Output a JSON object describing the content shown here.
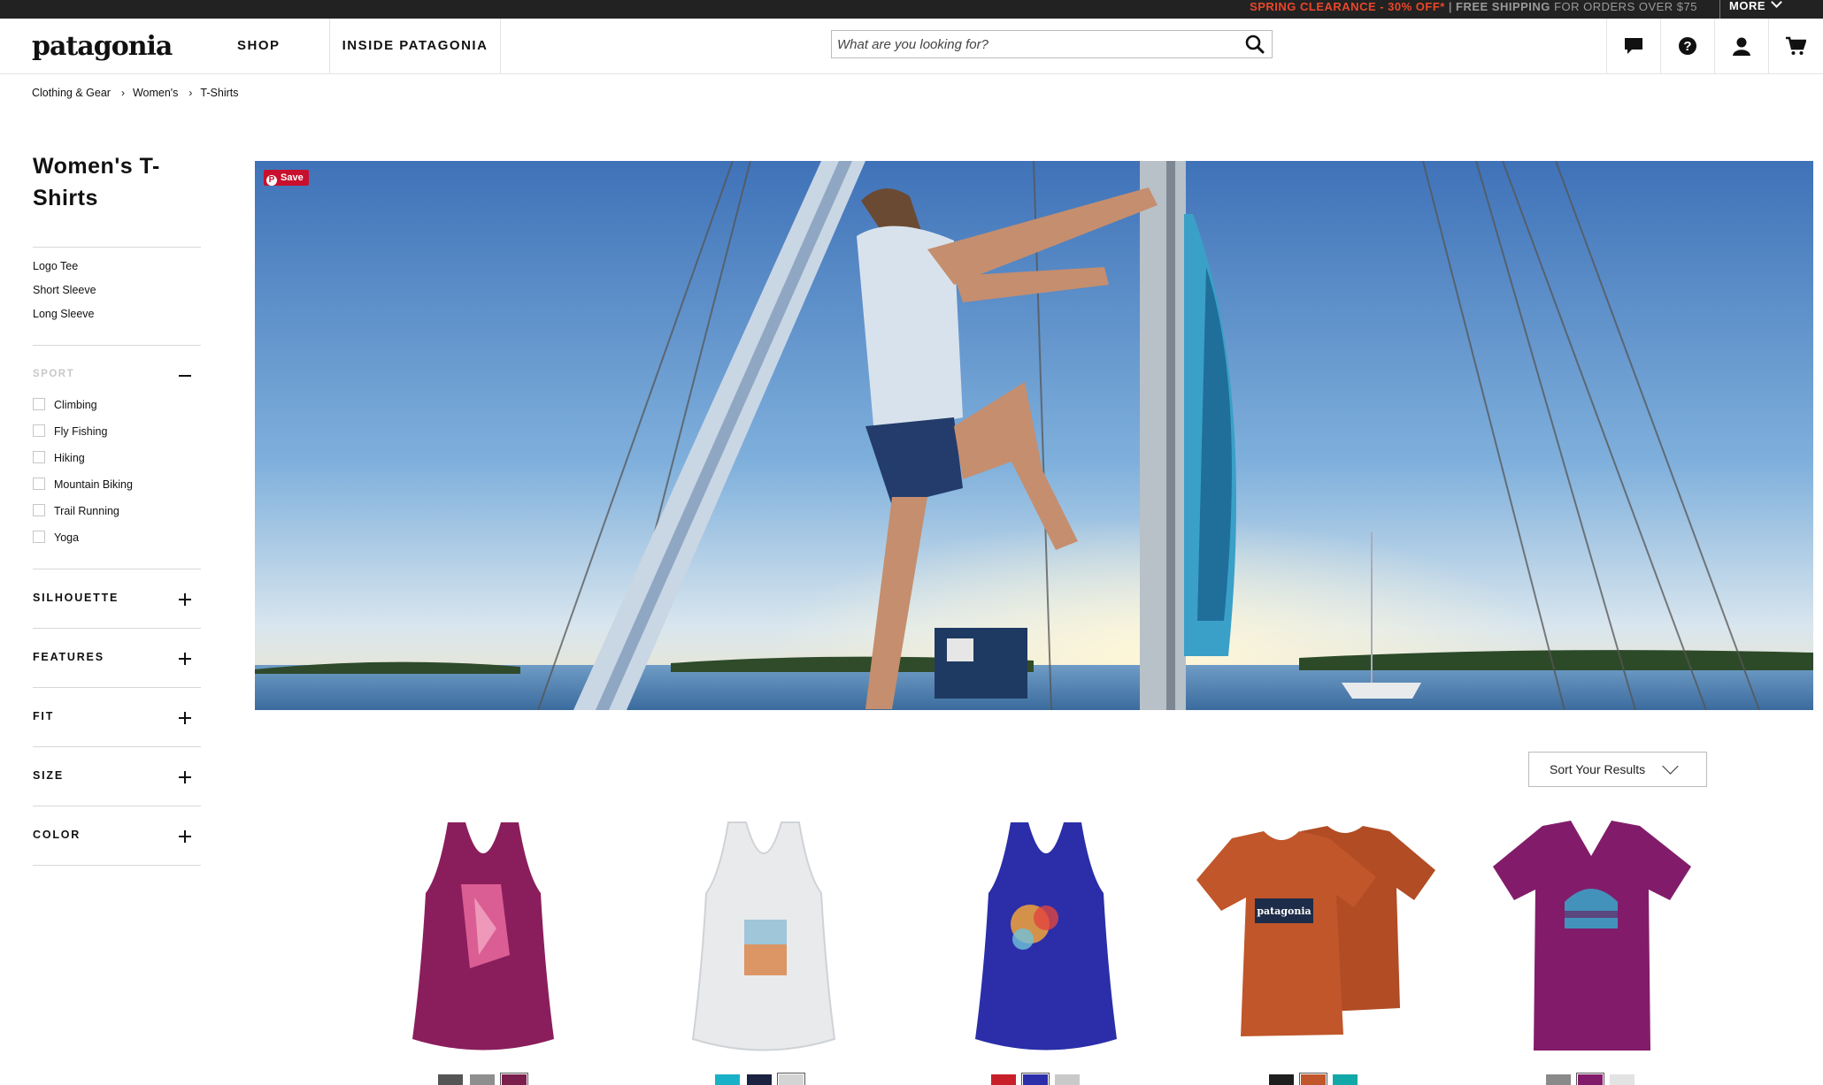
{
  "promo": {
    "clearance": "SPRING CLEARANCE - 30% OFF*",
    "separator": "|",
    "shipping_bold": "FREE SHIPPING",
    "shipping_rest": "FOR ORDERS OVER $75",
    "more": "MORE"
  },
  "header": {
    "logo": "patagonia",
    "nav": {
      "shop": "SHOP",
      "inside": "INSIDE PATAGONIA"
    },
    "search_placeholder": "What are you looking for?",
    "icons": [
      "chat-icon",
      "help-icon",
      "account-icon",
      "cart-icon"
    ]
  },
  "breadcrumb": {
    "items": [
      "Clothing & Gear",
      "Women's",
      "T-Shirts"
    ],
    "arrow": "›"
  },
  "sidebar": {
    "title": "Women's T-Shirts",
    "categories": [
      "Logo Tee",
      "Short Sleeve",
      "Long Sleeve"
    ],
    "sport": {
      "label": "SPORT",
      "options": [
        "Climbing",
        "Fly Fishing",
        "Hiking",
        "Mountain Biking",
        "Trail Running",
        "Yoga"
      ]
    },
    "facets": [
      "SILHOUETTE",
      "FEATURES",
      "FIT",
      "SIZE",
      "COLOR"
    ]
  },
  "hero": {
    "save_label": "Save"
  },
  "sort": {
    "label": "Sort Your Results"
  },
  "products": [
    {
      "type": "tank",
      "color": "#8a1e5c",
      "swatches": [
        "#555555",
        "#8e8e8e",
        "#7a1f4d"
      ]
    },
    {
      "type": "tank",
      "color": "#e9eaec",
      "swatches": [
        "#19b1c7",
        "#1b2340",
        "#d4d4d4"
      ]
    },
    {
      "type": "tank",
      "color": "#2b2ea8",
      "swatches": [
        "#c8202b",
        "#2b2ea8",
        "#c9c9c9"
      ]
    },
    {
      "type": "tee-pair",
      "color": "#c0562a",
      "swatches": [
        "#1e1e1e",
        "#c0562a",
        "#13a8a8"
      ]
    },
    {
      "type": "vneck",
      "color": "#821c6a",
      "swatches": [
        "#8a8a8a",
        "#821c6a",
        "#e3e3e3"
      ]
    }
  ]
}
